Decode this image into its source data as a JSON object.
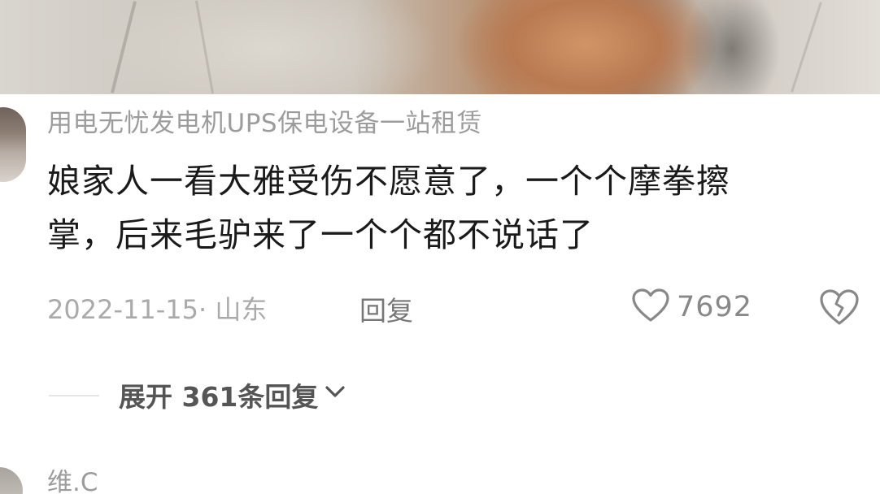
{
  "comment": {
    "username": "用电无忧发电机UPS保电设备一站租赁",
    "text_lines": [
      "娘家人一看大雅受伤不愿意了，一个个摩拳擦",
      "掌，后来毛驴来了一个个都不说话了"
    ],
    "date_location": "2022-11-15· 山东",
    "reply_label": "回复",
    "like_icon": "heart-outline-icon",
    "like_count": "7692",
    "dislike_icon": "broken-heart-icon"
  },
  "replies": {
    "expand_label": "展开 361条回复",
    "expand_icon": "chevron-down-icon"
  },
  "next_comment": {
    "username": "维.C"
  },
  "colors": {
    "username": "#9c9c9c",
    "text": "#1a1a1a",
    "meta": "#aaaaaa",
    "icon": "#888888"
  }
}
